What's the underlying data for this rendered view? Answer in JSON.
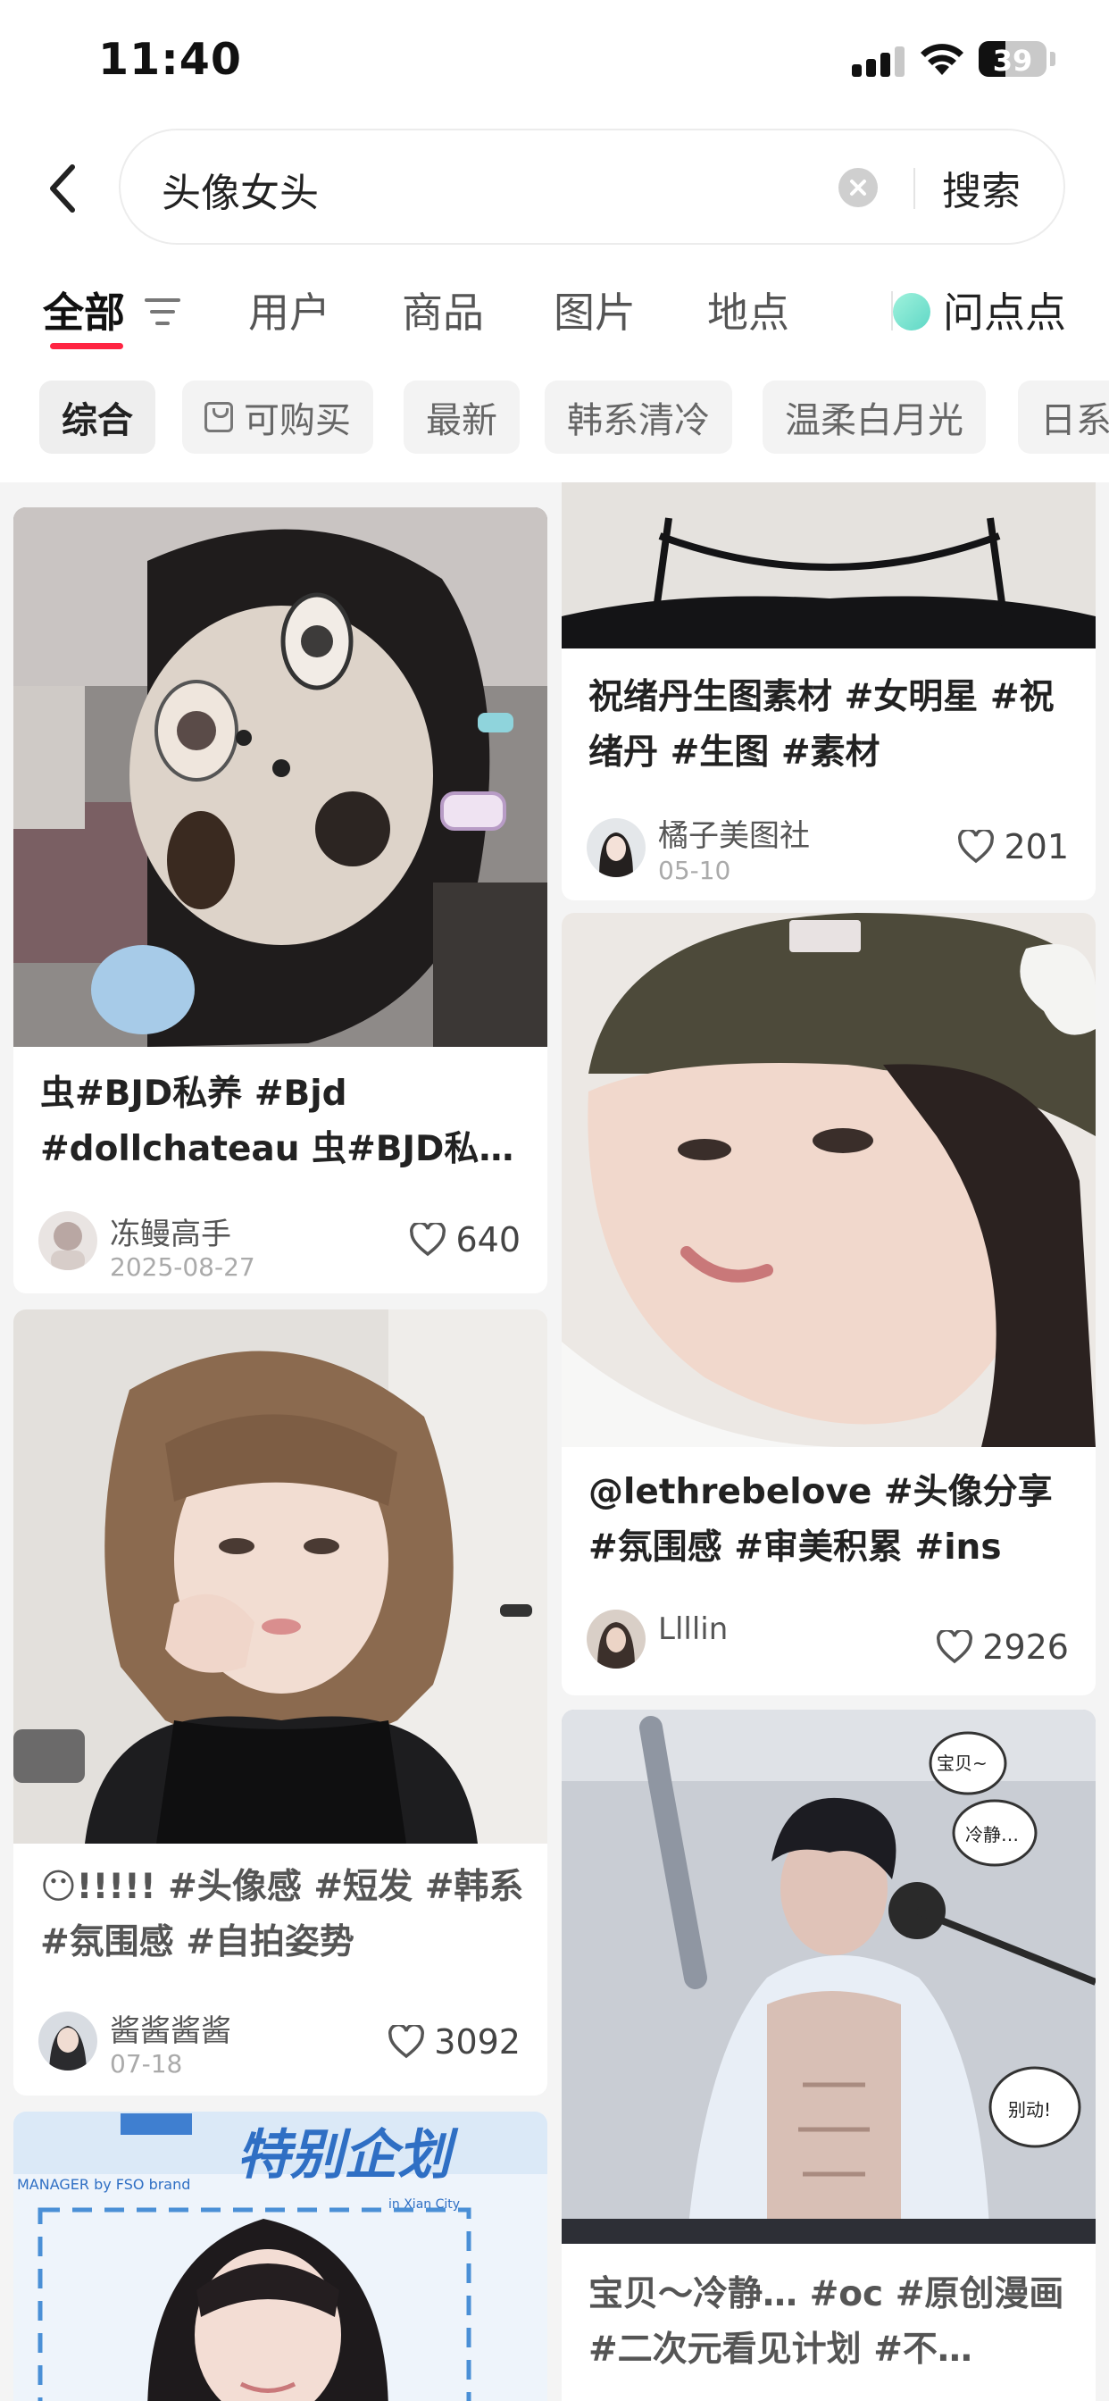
{
  "status_bar": {
    "time": "11:40",
    "battery": "39",
    "battery_level": 0.39
  },
  "search": {
    "query": "头像女头",
    "button_label": "搜索"
  },
  "tabs": [
    {
      "label": "全部",
      "active": true
    },
    {
      "label": "用户"
    },
    {
      "label": "商品"
    },
    {
      "label": "图片"
    },
    {
      "label": "地点"
    },
    {
      "label": "问点点"
    }
  ],
  "chips": [
    {
      "label": "综合",
      "active": true
    },
    {
      "label": "可购买",
      "icon": "shopping-bag-icon"
    },
    {
      "label": "最新"
    },
    {
      "label": "韩系清冷"
    },
    {
      "label": "温柔白月光"
    },
    {
      "label": "日系"
    }
  ],
  "colors": {
    "accent": "#ff2442",
    "background": "#f4f4f4",
    "card": "#ffffff"
  },
  "feed": {
    "left": [
      {
        "title": "虫#BJD私养 #Bjd #dollchateau 虫#BJD私…",
        "author": "冻鳗高手",
        "date": "2025-08-27",
        "likes": "640"
      },
      {
        "emoji": "😶",
        "title": "!!!!!  #头像感 #短发 #韩系 #氛围感 #自拍姿势",
        "author": "酱酱酱酱",
        "date": "07-18",
        "likes": "3092"
      },
      {
        "banner_text": "特别企划",
        "banner_small": "MANAGER by FSO brand",
        "banner_small2": "in Xian City"
      }
    ],
    "right": [
      {
        "title": "祝绪丹生图素材 #女明星 #祝绪丹 #生图 #素材",
        "author": "橘子美图社",
        "date": "05-10",
        "likes": "201"
      },
      {
        "title": "@lethrebelove #头像分享 #氛围感 #审美积累 #ins #i…",
        "author": "Llllin",
        "date": "",
        "likes": "2926"
      },
      {
        "title": "宝贝～冷静… #oc #原创漫画 #二次元看见计划 #不…",
        "bubbles": [
          "宝贝~",
          "冷静…",
          "别动!"
        ]
      }
    ]
  }
}
